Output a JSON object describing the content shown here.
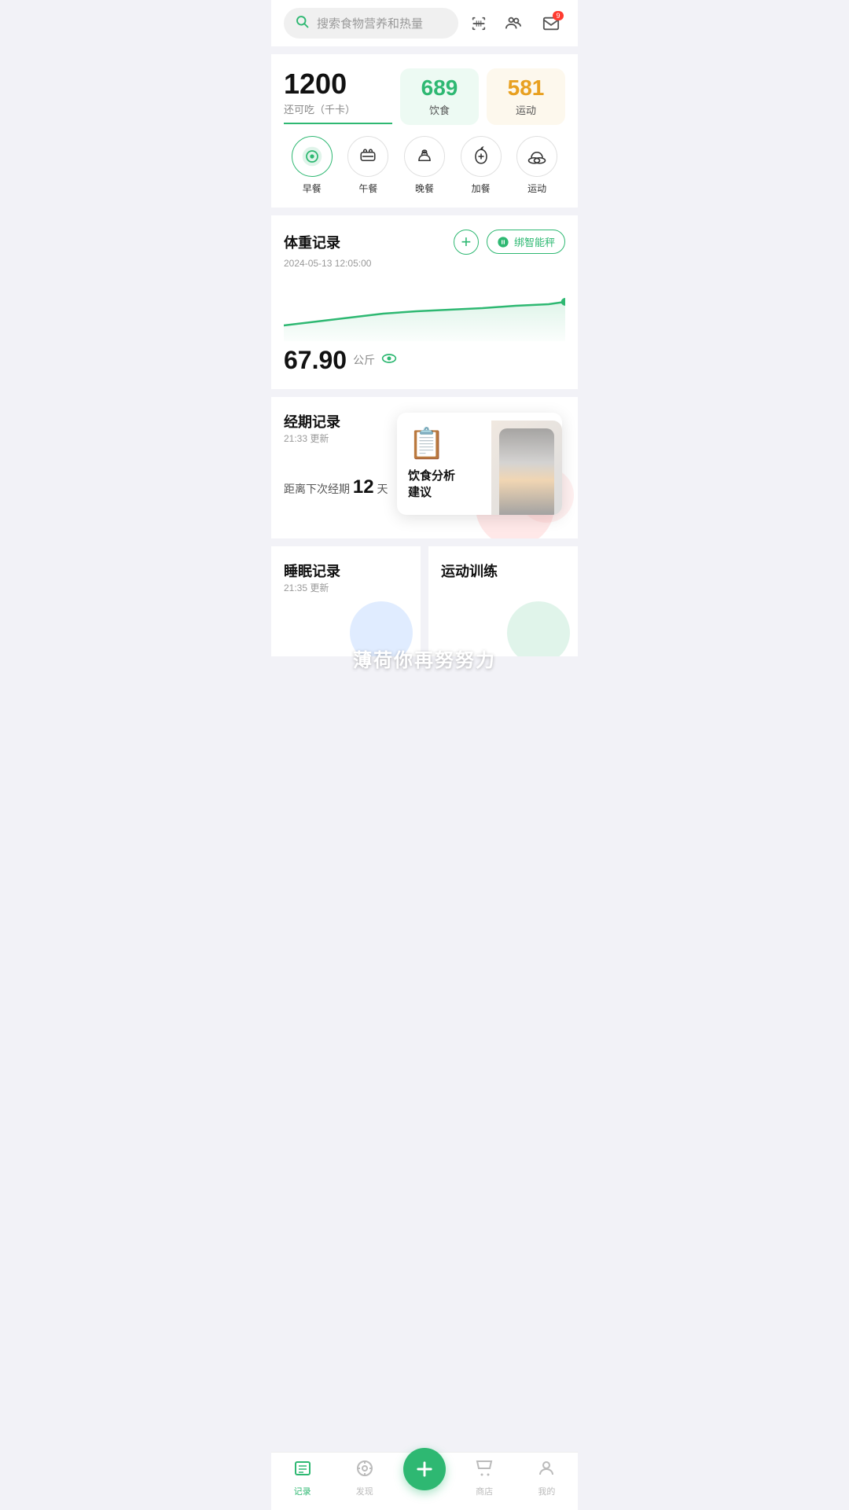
{
  "search": {
    "placeholder": "搜索食物营养和热量"
  },
  "header": {
    "badge": "9",
    "scan_label": "scan",
    "user_icon": "user",
    "mail_icon": "mail"
  },
  "calorie": {
    "remaining": "1200",
    "remaining_label": "还可吃（千卡）",
    "food_num": "689",
    "food_label": "饮食",
    "exercise_num": "581",
    "exercise_label": "运动"
  },
  "meals": [
    {
      "icon": "🥞",
      "label": "早餐",
      "active": true
    },
    {
      "icon": "🍔",
      "label": "午餐",
      "active": false
    },
    {
      "icon": "🍜",
      "label": "晚餐",
      "active": false
    },
    {
      "icon": "🍎",
      "label": "加餐",
      "active": false
    },
    {
      "icon": "👟",
      "label": "运动",
      "active": false
    }
  ],
  "weight": {
    "title": "体重记录",
    "date": "2024-05-13 12:05:00",
    "add_label": "+",
    "bind_label": "绑智能秤",
    "value": "67.90",
    "unit": "公斤"
  },
  "period": {
    "title": "经期记录",
    "update_time": "21:33 更新",
    "days_prefix": "距离下次经期",
    "days": "12",
    "days_suffix": "天"
  },
  "diet_popup": {
    "text": "饮食分析\n建议",
    "close": "×"
  },
  "sleep": {
    "title": "睡眠记录",
    "update_time": "21:35 更新"
  },
  "exercise": {
    "title": "运动训练"
  },
  "promo": {
    "text": "薄荷你再努努力"
  },
  "nav": [
    {
      "icon": "📅",
      "label": "记录",
      "active": true
    },
    {
      "icon": "🔍",
      "label": "发现",
      "active": false
    },
    {
      "icon": "+",
      "label": "",
      "active": false,
      "is_add": true
    },
    {
      "icon": "🏪",
      "label": "商店",
      "active": false
    },
    {
      "icon": "👤",
      "label": "我的",
      "active": false
    }
  ]
}
